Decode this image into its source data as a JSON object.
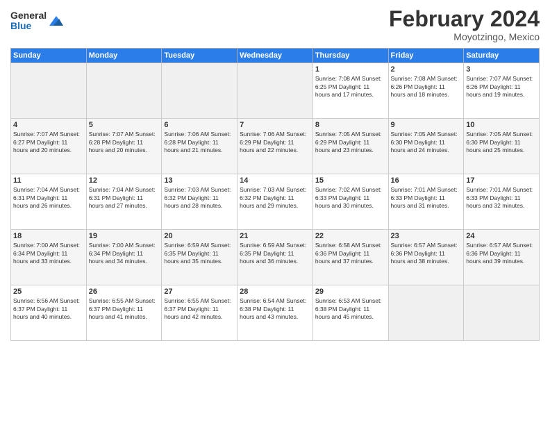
{
  "header": {
    "logo_general": "General",
    "logo_blue": "Blue",
    "month_title": "February 2024",
    "location": "Moyotzingo, Mexico"
  },
  "days_of_week": [
    "Sunday",
    "Monday",
    "Tuesday",
    "Wednesday",
    "Thursday",
    "Friday",
    "Saturday"
  ],
  "weeks": [
    [
      {
        "day": "",
        "info": ""
      },
      {
        "day": "",
        "info": ""
      },
      {
        "day": "",
        "info": ""
      },
      {
        "day": "",
        "info": ""
      },
      {
        "day": "1",
        "info": "Sunrise: 7:08 AM\nSunset: 6:25 PM\nDaylight: 11 hours and 17 minutes."
      },
      {
        "day": "2",
        "info": "Sunrise: 7:08 AM\nSunset: 6:26 PM\nDaylight: 11 hours and 18 minutes."
      },
      {
        "day": "3",
        "info": "Sunrise: 7:07 AM\nSunset: 6:26 PM\nDaylight: 11 hours and 19 minutes."
      }
    ],
    [
      {
        "day": "4",
        "info": "Sunrise: 7:07 AM\nSunset: 6:27 PM\nDaylight: 11 hours and 20 minutes."
      },
      {
        "day": "5",
        "info": "Sunrise: 7:07 AM\nSunset: 6:28 PM\nDaylight: 11 hours and 20 minutes."
      },
      {
        "day": "6",
        "info": "Sunrise: 7:06 AM\nSunset: 6:28 PM\nDaylight: 11 hours and 21 minutes."
      },
      {
        "day": "7",
        "info": "Sunrise: 7:06 AM\nSunset: 6:29 PM\nDaylight: 11 hours and 22 minutes."
      },
      {
        "day": "8",
        "info": "Sunrise: 7:05 AM\nSunset: 6:29 PM\nDaylight: 11 hours and 23 minutes."
      },
      {
        "day": "9",
        "info": "Sunrise: 7:05 AM\nSunset: 6:30 PM\nDaylight: 11 hours and 24 minutes."
      },
      {
        "day": "10",
        "info": "Sunrise: 7:05 AM\nSunset: 6:30 PM\nDaylight: 11 hours and 25 minutes."
      }
    ],
    [
      {
        "day": "11",
        "info": "Sunrise: 7:04 AM\nSunset: 6:31 PM\nDaylight: 11 hours and 26 minutes."
      },
      {
        "day": "12",
        "info": "Sunrise: 7:04 AM\nSunset: 6:31 PM\nDaylight: 11 hours and 27 minutes."
      },
      {
        "day": "13",
        "info": "Sunrise: 7:03 AM\nSunset: 6:32 PM\nDaylight: 11 hours and 28 minutes."
      },
      {
        "day": "14",
        "info": "Sunrise: 7:03 AM\nSunset: 6:32 PM\nDaylight: 11 hours and 29 minutes."
      },
      {
        "day": "15",
        "info": "Sunrise: 7:02 AM\nSunset: 6:33 PM\nDaylight: 11 hours and 30 minutes."
      },
      {
        "day": "16",
        "info": "Sunrise: 7:01 AM\nSunset: 6:33 PM\nDaylight: 11 hours and 31 minutes."
      },
      {
        "day": "17",
        "info": "Sunrise: 7:01 AM\nSunset: 6:33 PM\nDaylight: 11 hours and 32 minutes."
      }
    ],
    [
      {
        "day": "18",
        "info": "Sunrise: 7:00 AM\nSunset: 6:34 PM\nDaylight: 11 hours and 33 minutes."
      },
      {
        "day": "19",
        "info": "Sunrise: 7:00 AM\nSunset: 6:34 PM\nDaylight: 11 hours and 34 minutes."
      },
      {
        "day": "20",
        "info": "Sunrise: 6:59 AM\nSunset: 6:35 PM\nDaylight: 11 hours and 35 minutes."
      },
      {
        "day": "21",
        "info": "Sunrise: 6:59 AM\nSunset: 6:35 PM\nDaylight: 11 hours and 36 minutes."
      },
      {
        "day": "22",
        "info": "Sunrise: 6:58 AM\nSunset: 6:36 PM\nDaylight: 11 hours and 37 minutes."
      },
      {
        "day": "23",
        "info": "Sunrise: 6:57 AM\nSunset: 6:36 PM\nDaylight: 11 hours and 38 minutes."
      },
      {
        "day": "24",
        "info": "Sunrise: 6:57 AM\nSunset: 6:36 PM\nDaylight: 11 hours and 39 minutes."
      }
    ],
    [
      {
        "day": "25",
        "info": "Sunrise: 6:56 AM\nSunset: 6:37 PM\nDaylight: 11 hours and 40 minutes."
      },
      {
        "day": "26",
        "info": "Sunrise: 6:55 AM\nSunset: 6:37 PM\nDaylight: 11 hours and 41 minutes."
      },
      {
        "day": "27",
        "info": "Sunrise: 6:55 AM\nSunset: 6:37 PM\nDaylight: 11 hours and 42 minutes."
      },
      {
        "day": "28",
        "info": "Sunrise: 6:54 AM\nSunset: 6:38 PM\nDaylight: 11 hours and 43 minutes."
      },
      {
        "day": "29",
        "info": "Sunrise: 6:53 AM\nSunset: 6:38 PM\nDaylight: 11 hours and 45 minutes."
      },
      {
        "day": "",
        "info": ""
      },
      {
        "day": "",
        "info": ""
      }
    ]
  ]
}
